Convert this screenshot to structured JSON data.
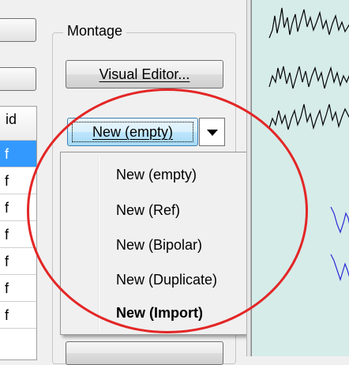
{
  "left_panel": {
    "table_header": "id",
    "rows": [
      "f",
      "f",
      "f",
      "f",
      "f",
      "f",
      "f"
    ]
  },
  "montage": {
    "group_title": "Montage",
    "visual_editor_button": "Visual Editor...",
    "new_button": "New (empty)"
  },
  "dropdown_menu": {
    "items": [
      {
        "label": "New (empty)",
        "bold": false
      },
      {
        "label": "New (Ref)",
        "bold": false
      },
      {
        "label": "New (Bipolar)",
        "bold": false
      },
      {
        "label": "New (Duplicate)",
        "bold": false
      },
      {
        "label": "New (Import)",
        "bold": true
      }
    ]
  },
  "colors": {
    "annotation_circle": "#e32626",
    "selected_row": "#3399ff",
    "eeg_background": "#d6ece9",
    "trace_black": "#000000",
    "trace_blue": "#2a2ad6"
  }
}
